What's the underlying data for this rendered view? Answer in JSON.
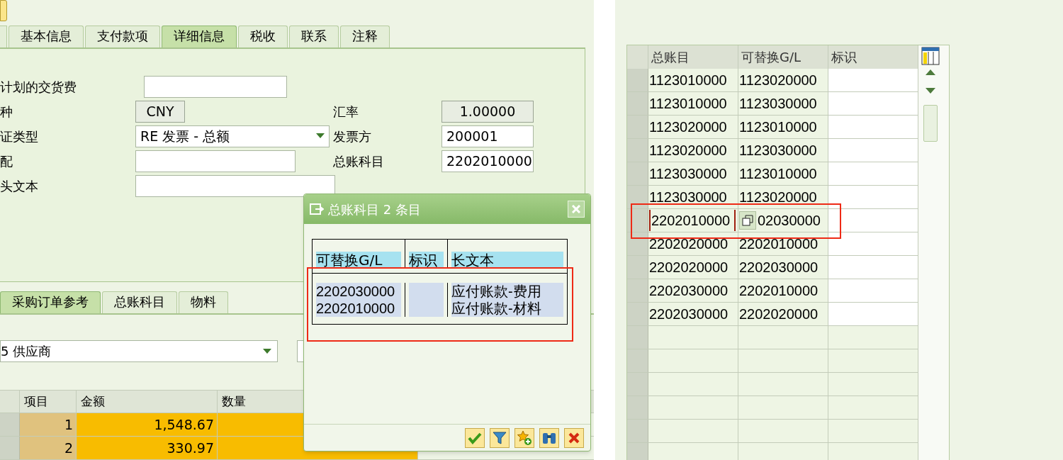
{
  "main_tabs": [
    {
      "label": "基本信息",
      "selected": false
    },
    {
      "label": "支付款项",
      "selected": false
    },
    {
      "label": "详细信息",
      "selected": true
    },
    {
      "label": "税收",
      "selected": false
    },
    {
      "label": "联系",
      "selected": false
    },
    {
      "label": "注释",
      "selected": false
    }
  ],
  "form": [
    {
      "label": "计划的交货费",
      "field": {
        "kind": "input"
      }
    },
    {
      "label": "种",
      "field": {
        "kind": "display",
        "value": "CNY"
      },
      "right": {
        "label": "汇率",
        "field": {
          "kind": "display",
          "value": "1.00000"
        }
      }
    },
    {
      "label": "证类型",
      "field": {
        "kind": "dropdown",
        "value": "RE 发票 - 总额"
      },
      "right": {
        "label": "发票方",
        "field": {
          "kind": "input",
          "value": "200001"
        }
      }
    },
    {
      "label": "配",
      "field": {
        "kind": "input"
      },
      "right": {
        "label": "总账科目",
        "field": {
          "kind": "input",
          "value": "2202010000"
        }
      }
    },
    {
      "label": "头文本",
      "field": {
        "kind": "input"
      }
    }
  ],
  "item_tabs": [
    {
      "label": "采购订单参考",
      "selected": true
    },
    {
      "label": "总账科目",
      "selected": false
    },
    {
      "label": "物料",
      "selected": false
    }
  ],
  "reference_dropdown": {
    "value": "5 供应商"
  },
  "items_table": {
    "columns": [
      "项目",
      "金额",
      "数量"
    ],
    "rows": [
      {
        "cells": [
          "1",
          "1,548.67",
          ""
        ]
      },
      {
        "cells": [
          "2",
          "330.97",
          ""
        ]
      }
    ]
  },
  "popup": {
    "title": "总账科目 2 条目",
    "columns": [
      "可替换G/L",
      "标识",
      "长文本"
    ],
    "rows": [
      {
        "cells": [
          "2202030000",
          "",
          "应付账款-费用"
        ]
      },
      {
        "cells": [
          "2202010000",
          "",
          "应付账款-材料"
        ]
      }
    ],
    "buttons": [
      {
        "kind": "confirm"
      },
      {
        "kind": "filter"
      },
      {
        "kind": "add-favorite"
      },
      {
        "kind": "find"
      },
      {
        "kind": "cancel"
      }
    ]
  },
  "gl_table": {
    "columns": [
      "总账目",
      "可替换G/L",
      "标识"
    ],
    "rows": [
      {
        "cells": [
          "1123010000",
          "1123020000",
          ""
        ],
        "focused": false
      },
      {
        "cells": [
          "1123010000",
          "1123030000",
          ""
        ],
        "focused": false
      },
      {
        "cells": [
          "1123020000",
          "1123010000",
          ""
        ],
        "focused": false
      },
      {
        "cells": [
          "1123020000",
          "1123030000",
          ""
        ],
        "focused": false
      },
      {
        "cells": [
          "1123030000",
          "1123010000",
          ""
        ],
        "focused": false
      },
      {
        "cells": [
          "1123030000",
          "1123020000",
          ""
        ],
        "focused": false
      },
      {
        "cells": [
          "2202010000",
          "02030000",
          ""
        ],
        "focused": true
      },
      {
        "cells": [
          "2202020000",
          "2202010000",
          ""
        ],
        "focused": false
      },
      {
        "cells": [
          "2202020000",
          "2202030000",
          ""
        ],
        "focused": false
      },
      {
        "cells": [
          "2202030000",
          "2202010000",
          ""
        ],
        "focused": false
      },
      {
        "cells": [
          "2202030000",
          "2202020000",
          ""
        ],
        "focused": false
      }
    ]
  }
}
